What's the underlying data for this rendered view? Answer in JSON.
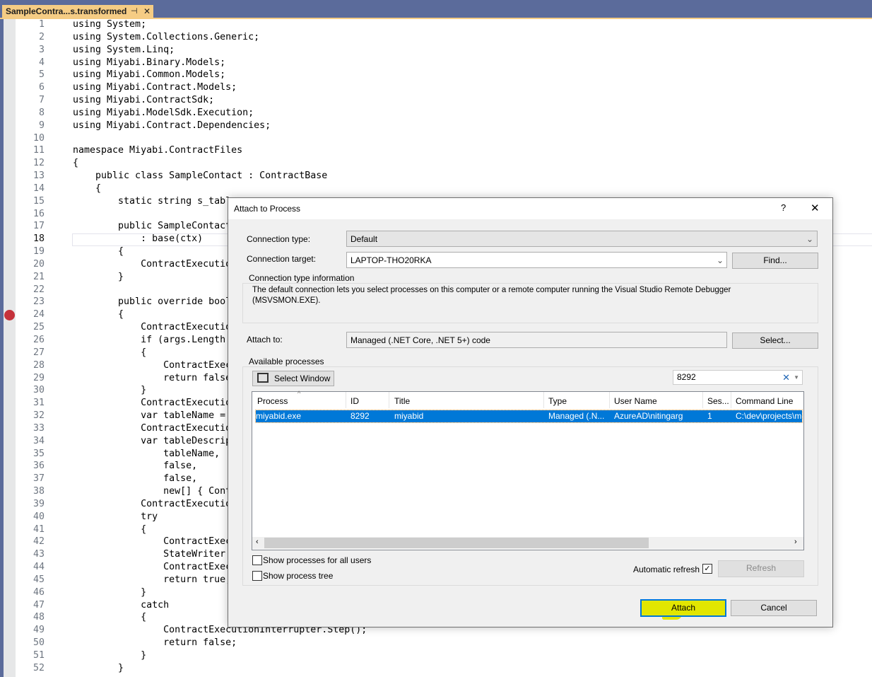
{
  "editor": {
    "tab_title": "SampleContra...s.transformed",
    "current_line": 18,
    "breakpoint_line": 24,
    "lines": [
      "using System;",
      "using System.Collections.Generic;",
      "using System.Linq;",
      "using Miyabi.Binary.Models;",
      "using Miyabi.Common.Models;",
      "using Miyabi.Contract.Models;",
      "using Miyabi.ContractSdk;",
      "using Miyabi.ModelSdk.Execution;",
      "using Miyabi.Contract.Dependencies;",
      "",
      "namespace Miyabi.ContractFiles",
      "{",
      "    public class SampleContact : ContractBase",
      "    {",
      "        static string s_tabl",
      "",
      "        public SampleContact",
      "            : base(ctx)",
      "        {",
      "            ContractExecutio",
      "        }",
      "",
      "        public override bool",
      "        {",
      "            ContractExecutio",
      "            if (args.Length",
      "            {",
      "                ContractExec",
      "                return false",
      "            }",
      "            ContractExecutio",
      "            var tableName =",
      "            ContractExecutio",
      "            var tableDescrip",
      "                tableName,",
      "                false,",
      "                false,",
      "                new[] { Cont",
      "            ContractExecutio",
      "            try",
      "            {",
      "                ContractExec",
      "                StateWriter.",
      "                ContractExec",
      "                return true;",
      "            }",
      "            catch",
      "            {",
      "                ContractExecutionInterrupter.Step();",
      "                return false;",
      "            }",
      "        }"
    ]
  },
  "dialog": {
    "title": "Attach to Process",
    "help": "?",
    "close": "✕",
    "connection_type_label": "Connection type:",
    "connection_type_value": "Default",
    "connection_target_label": "Connection target:",
    "connection_target_value": "LAPTOP-THO20RKA",
    "find_button": "Find...",
    "info_group_title": "Connection type information",
    "info_text": "The default connection lets you select processes on this computer or a remote computer running the Visual Studio Remote Debugger (MSVSMON.EXE).",
    "attach_to_label": "Attach to:",
    "attach_to_value": "Managed (.NET Core, .NET 5+) code",
    "select_button": "Select...",
    "processes_group_title": "Available processes",
    "select_window_button": "Select Window",
    "filter_value": "8292",
    "columns": [
      "Process",
      "ID",
      "Title",
      "Type",
      "User Name",
      "Ses...",
      "Command Line"
    ],
    "rows": [
      {
        "process": "miyabid.exe",
        "id": "8292",
        "title": "miyabid",
        "type": "Managed (.N...",
        "user": "AzureAD\\nitingarg",
        "session": "1",
        "command": "C:\\dev\\projects\\m"
      }
    ],
    "show_all_users_label": "Show processes for all users",
    "show_all_users_checked": false,
    "show_tree_label": "Show process tree",
    "show_tree_checked": false,
    "auto_refresh_label": "Automatic refresh",
    "auto_refresh_checked": true,
    "refresh_button": "Refresh",
    "attach_button": "Attach",
    "cancel_button": "Cancel",
    "selection_color": "#0078d7",
    "highlight_color": "#e2e600"
  }
}
